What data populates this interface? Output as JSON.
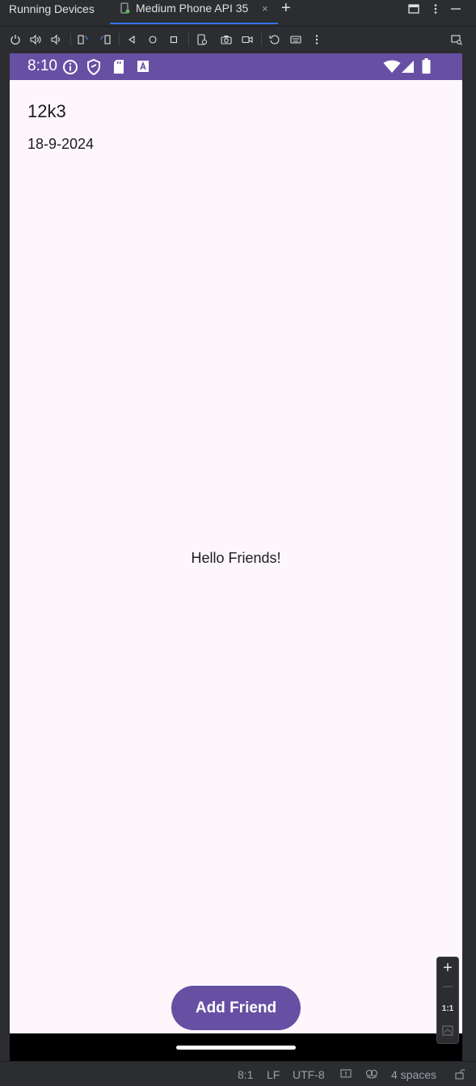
{
  "ide": {
    "tool_window_title": "Running Devices",
    "tab_label": "Medium Phone API 35",
    "tab_close": "×",
    "add_tab": "+"
  },
  "device": {
    "status_time": "8:10",
    "app_title": "12k3",
    "date": "18-9-2024",
    "greeting": "Hello Friends!",
    "fab_label": "Add Friend"
  },
  "zoom": {
    "zoom_in": "+",
    "zoom_out": "—",
    "actual_size": "1:1"
  },
  "status_bar": {
    "position": "8:1",
    "line_separator": "LF",
    "encoding": "UTF-8",
    "indent": "4 spaces"
  },
  "colors": {
    "accent": "#6750a4",
    "background": "#fdf7fc",
    "ide_bg": "#2b2d30"
  }
}
